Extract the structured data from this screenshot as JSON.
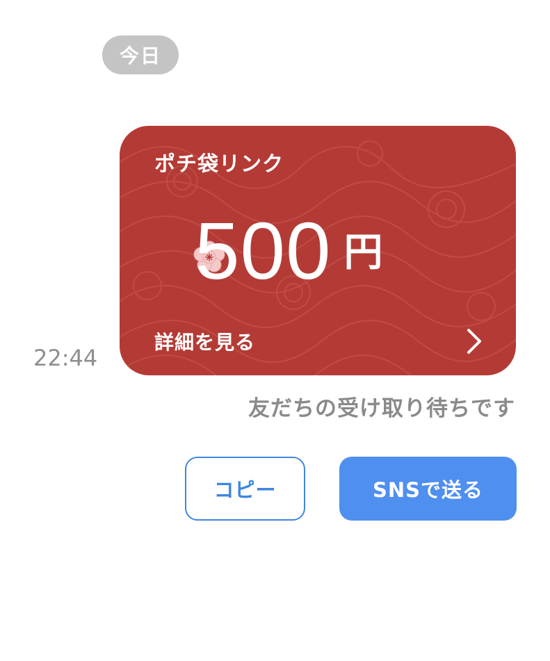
{
  "chat": {
    "date_label": "今日",
    "timestamp": "22:44"
  },
  "card": {
    "title": "ポチ袋リンク",
    "amount": "500",
    "currency": "円",
    "detail_label": "詳細を見る",
    "background_color": "#b43b35",
    "icons": {
      "flower": "plum-blossom-icon",
      "arrow": "chevron-right-icon"
    }
  },
  "status": {
    "text": "友だちの受け取り待ちです"
  },
  "actions": {
    "copy_label": "コピー",
    "sns_label": "SNSで送る",
    "accent_color": "#4f8fef"
  }
}
